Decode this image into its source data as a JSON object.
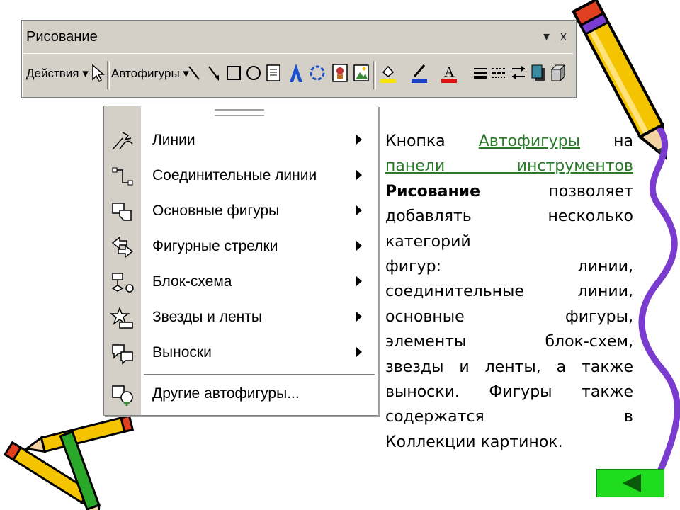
{
  "toolbar": {
    "title": "Рисование",
    "title_menu_glyph": "▾",
    "close_glyph": "x",
    "actions_label": "Действия ▾",
    "autoshapes_label": "Автофигуры ▾"
  },
  "menu": {
    "items": [
      {
        "label": "Линии",
        "has_submenu": true
      },
      {
        "label": "Соединительные линии",
        "has_submenu": true
      },
      {
        "label": "Основные фигуры",
        "has_submenu": true
      },
      {
        "label": "Фигурные стрелки",
        "has_submenu": true
      },
      {
        "label": "Блок-схема",
        "has_submenu": true
      },
      {
        "label": "Звезды и ленты",
        "has_submenu": true
      },
      {
        "label": "Выноски",
        "has_submenu": true
      },
      {
        "label": "Другие автофигуры...",
        "has_submenu": false
      }
    ]
  },
  "description": {
    "l1_a": "Кнопка",
    "l1_link": "Автофигуры",
    "l1_b": "на",
    "l2_link": "панели инструментов",
    "l3_bold": "Рисование",
    "l3_b": "позволяет",
    "l4": "добавлять несколько",
    "l5": "категорий",
    "l6": "фигур: линии,",
    "l7": "соединительные линии,",
    "l8": "основные фигуры,",
    "l9": "элементы блок-схем,",
    "l10": "звезды и ленты, а также",
    "l11": "выноски. Фигуры также",
    "l12": "содержатся в",
    "l13": "Коллекции картинок."
  },
  "colors": {
    "link": "#2a7a2a",
    "nav_button": "#1fdc1f",
    "toolbar_bg": "#d4d0c8",
    "pencil_yellow": "#f5c400",
    "pencil_purple": "#7a3ccf"
  },
  "nav": {
    "back_icon": "triangle-left-icon"
  }
}
